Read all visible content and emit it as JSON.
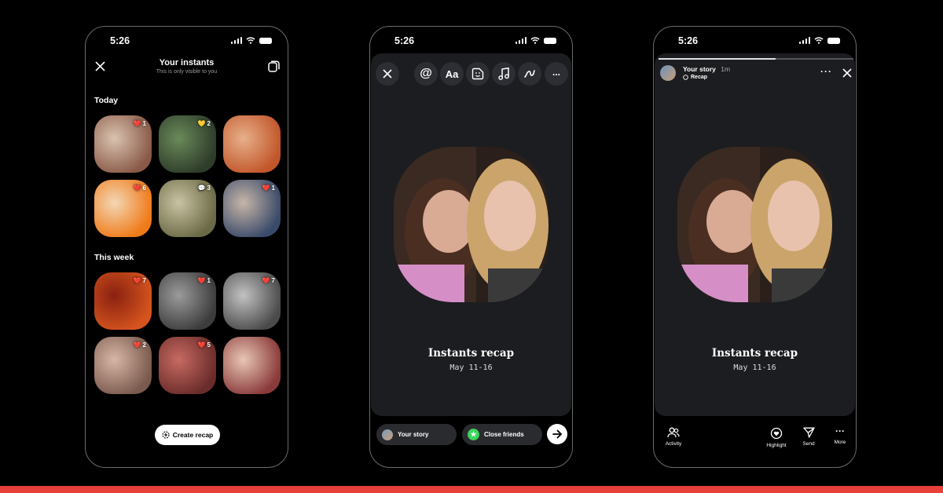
{
  "status": {
    "time": "5:26"
  },
  "instants": {
    "title": "Your instants",
    "subtitle": "This is only visible to you",
    "sections": [
      {
        "label": "Today",
        "tiles": [
          {
            "reaction": "❤️",
            "count": "1",
            "c1": "#8a5a48",
            "c2": "#d9c3b0"
          },
          {
            "reaction": "💛",
            "count": "2",
            "c1": "#2e3c2a",
            "c2": "#6a8a5a"
          },
          {
            "reaction": "",
            "count": "",
            "c1": "#c2562a",
            "c2": "#e7b08a"
          },
          {
            "reaction": "❤️",
            "count": "6",
            "c1": "#ef7a18",
            "c2": "#f3d7b5"
          },
          {
            "reaction": "💬",
            "count": "3",
            "c1": "#6b6a46",
            "c2": "#c9c3a3"
          },
          {
            "reaction": "❤️",
            "count": "1",
            "c1": "#3a4a6a",
            "c2": "#c7b6a8"
          }
        ]
      },
      {
        "label": "This week",
        "tiles": [
          {
            "reaction": "❤️",
            "count": "7",
            "c1": "#d5541e",
            "c2": "#8a2110"
          },
          {
            "reaction": "❤️",
            "count": "1",
            "c1": "#3c3c3c",
            "c2": "#9b9b9b"
          },
          {
            "reaction": "❤️",
            "count": "7",
            "c1": "#4b4b4b",
            "c2": "#c2c2c2"
          },
          {
            "reaction": "❤️",
            "count": "2",
            "c1": "#7a5a4e",
            "c2": "#d8b6a6"
          },
          {
            "reaction": "❤️",
            "count": "5",
            "c1": "#6a2c2a",
            "c2": "#c86a62"
          },
          {
            "reaction": "",
            "count": "",
            "c1": "#8a3a3a",
            "c2": "#e8c6b6"
          }
        ]
      }
    ],
    "create_recap": "Create recap"
  },
  "editor": {
    "tools": [
      "@",
      "Aa",
      "sticker",
      "music",
      "draw",
      "..."
    ],
    "title": "Instants recap",
    "date": "May 11-16",
    "your_story": "Your story",
    "close_friends": "Close friends"
  },
  "viewer": {
    "story_name": "Your story",
    "story_age": "1m",
    "story_tag": "Recap",
    "title": "Instants recap",
    "date": "May 11-16",
    "actions": [
      "Activity",
      "Highlight",
      "Send",
      "More"
    ]
  },
  "colors": {
    "accent_bar": "#e8413a",
    "screen_bg": "#1c1d20",
    "close_friends_green": "#3bd45a"
  }
}
